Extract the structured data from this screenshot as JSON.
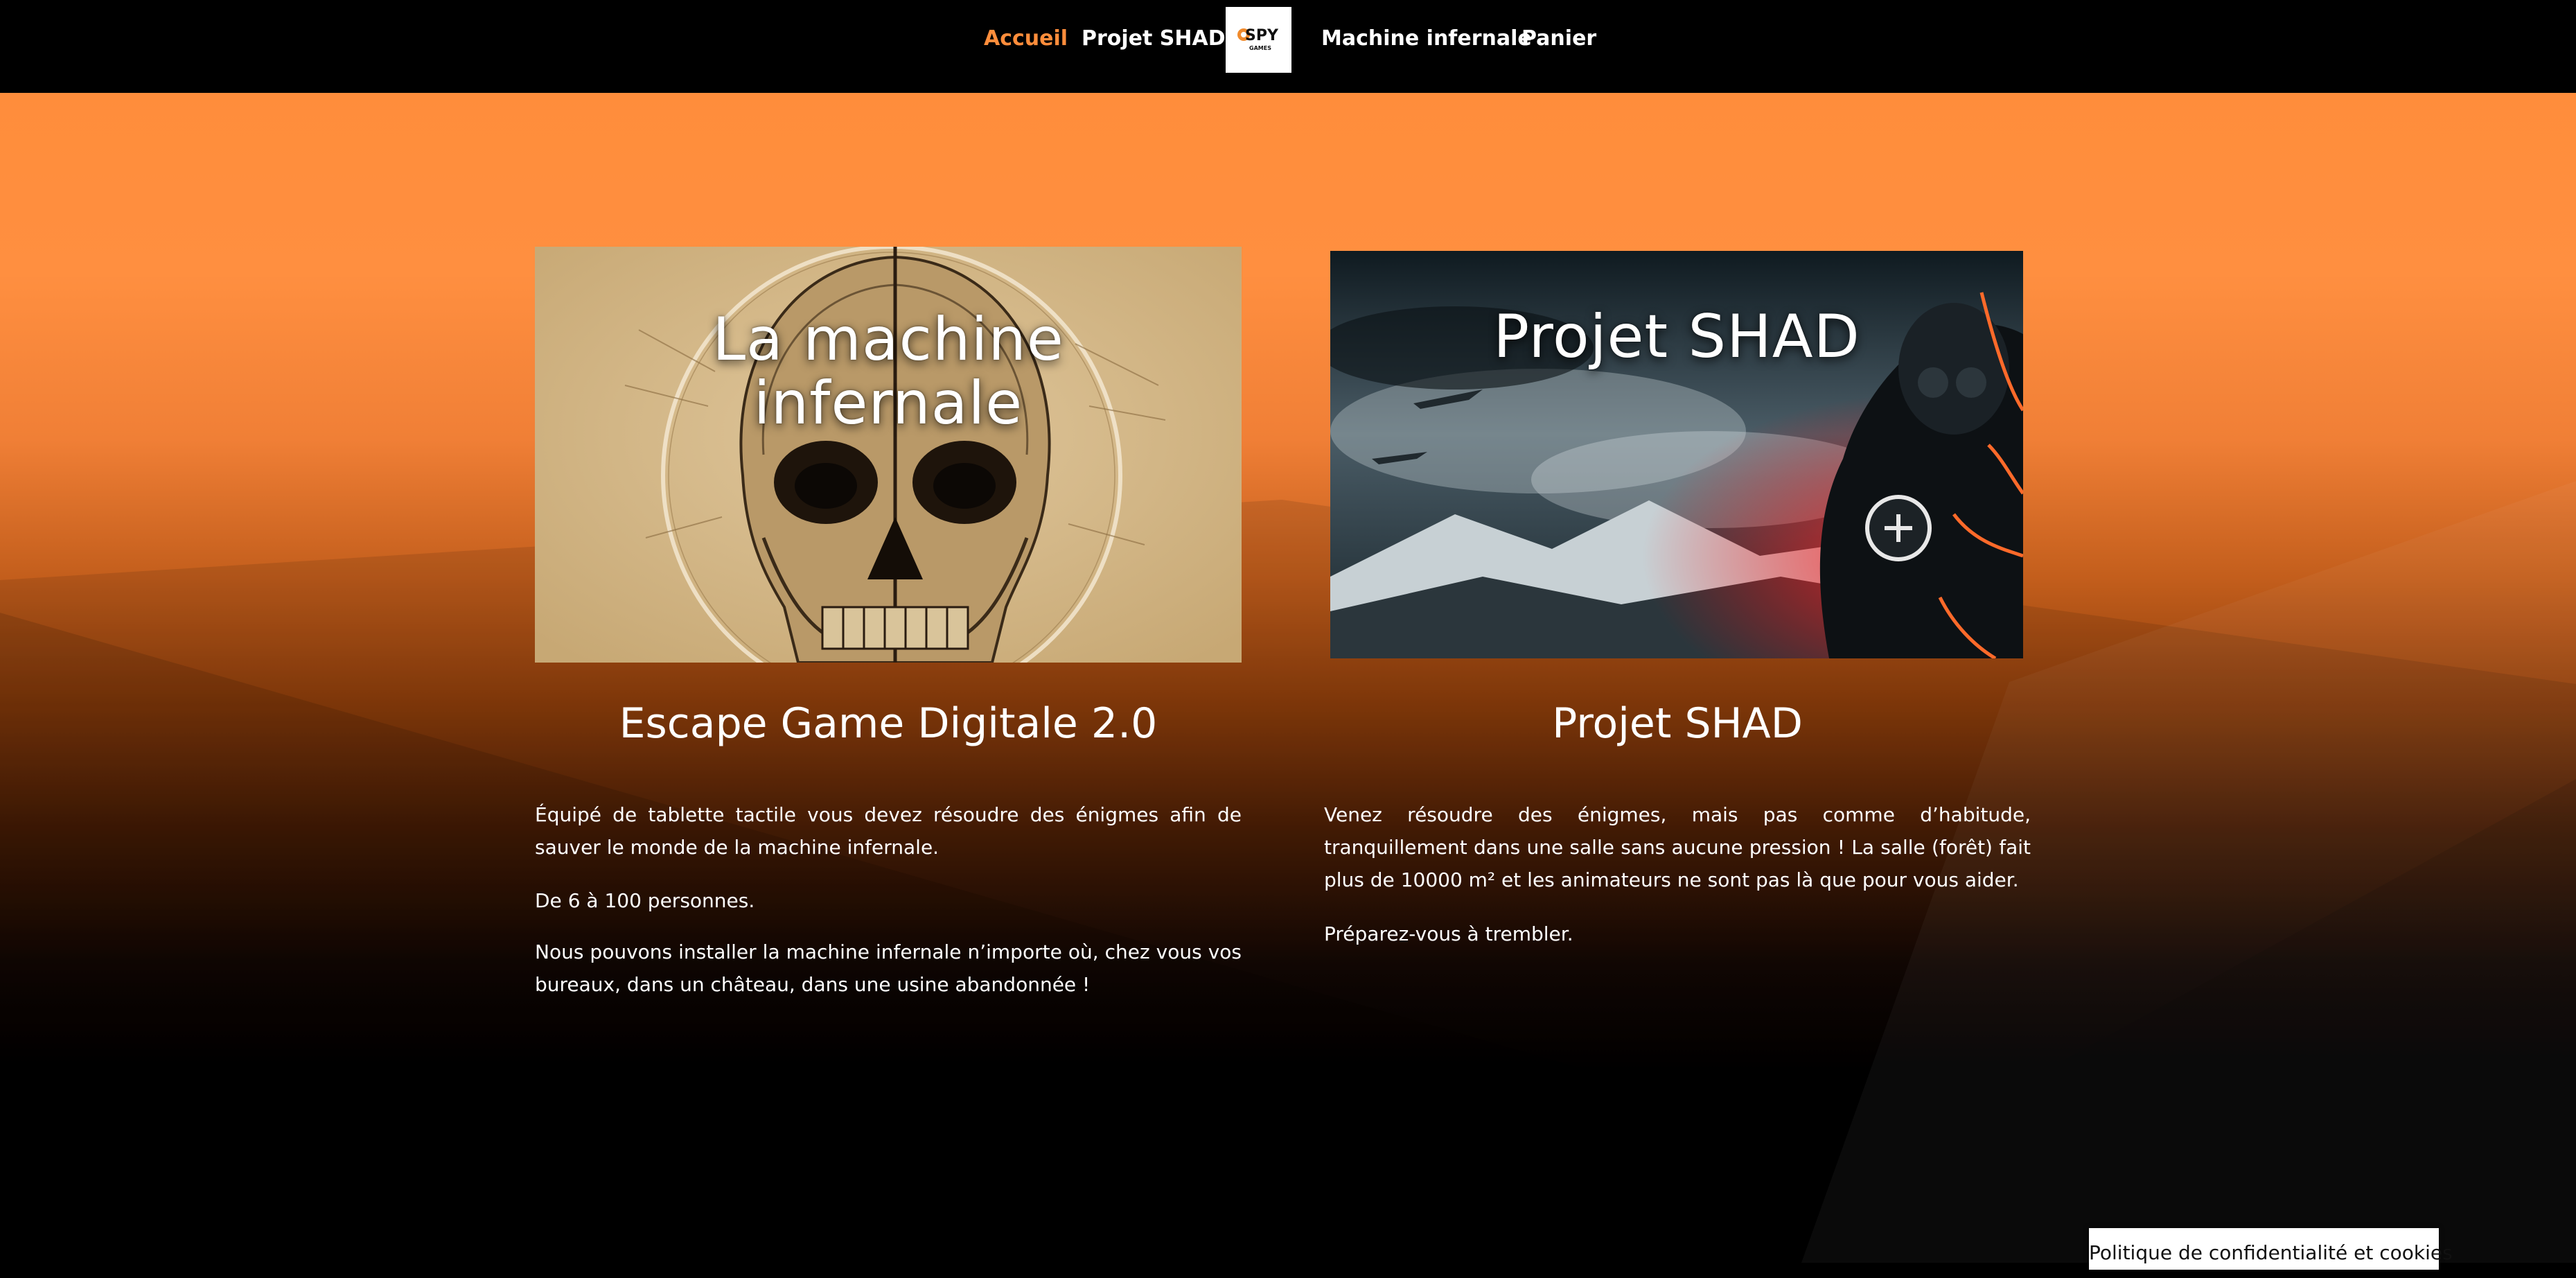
{
  "nav": {
    "items": [
      {
        "label": "Accueil",
        "active": true
      },
      {
        "label": "Projet SHAD",
        "active": false
      },
      {
        "label": "Machine infernale",
        "active": false
      },
      {
        "label": "Panier",
        "active": false
      }
    ],
    "logo_text_top": "SPY",
    "logo_text_bottom": "GAMES",
    "active_color": "#ff8d3b"
  },
  "hero": {
    "bg_color_top": "#ff8d3b",
    "bg_color_bottom": "#000000"
  },
  "cards": [
    {
      "image_title_lines": [
        "La machine",
        "infernale"
      ],
      "heading": "Escape Game Digitale 2.0",
      "paragraphs": [
        "Équipé de tablette tactile vous devez résoudre des énigmes afin de sauver le monde de la machine infernale.",
        "De 6 à 100 personnes.",
        "Nous pouvons installer la machine infernale n’importe où, chez vous vos bureaux, dans un château, dans une usine abandonnée !"
      ]
    },
    {
      "image_title_lines": [
        "Projet SHAD"
      ],
      "heading": "Projet SHAD",
      "paragraphs": [
        "Venez résoudre des énigmes, mais pas comme d’habitude, tranquillement dans une salle sans aucune pression ! La salle (forêt) fait plus de 10000 m² et les animateurs ne sont pas là que pour vous aider.",
        "Préparez-vous à trembler."
      ]
    }
  ],
  "cookie_button": "Politique de confidentialité et cookies"
}
